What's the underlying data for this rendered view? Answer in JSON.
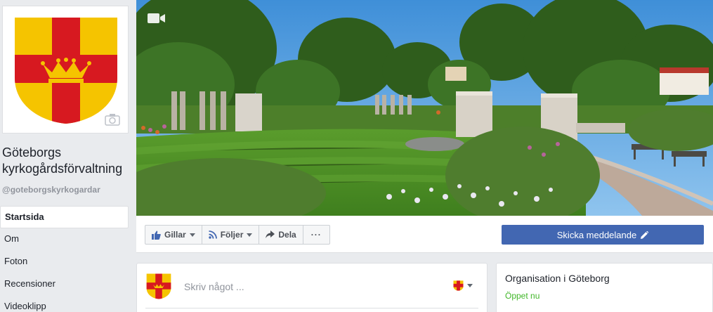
{
  "page": {
    "name_line1": "Göteborgs",
    "name_line2": "kyrkogårdsförvaltning",
    "handle": "@goteborgskyrkogardar"
  },
  "nav": {
    "items": [
      {
        "label": "Startsida",
        "active": true
      },
      {
        "label": "Om"
      },
      {
        "label": "Foton"
      },
      {
        "label": "Recensioner"
      },
      {
        "label": "Videoklipp"
      }
    ]
  },
  "actions": {
    "like_label": "Gillar",
    "follow_label": "Följer",
    "share_label": "Dela",
    "more_label": "···",
    "send_message_label": "Skicka meddelande"
  },
  "composer": {
    "placeholder": "Skriv något ..."
  },
  "info": {
    "category": "Organisation i Göteborg",
    "status": "Öppet nu"
  },
  "icons": {
    "camera": "camera-icon",
    "video": "video-icon",
    "like": "thumbs-up-icon",
    "follow": "rss-icon",
    "share": "share-arrow-icon",
    "edit": "pencil-icon"
  },
  "colors": {
    "brand_blue": "#4267b2",
    "open_green": "#42b72a",
    "shield_yellow": "#f5c400",
    "shield_red": "#d71920"
  }
}
